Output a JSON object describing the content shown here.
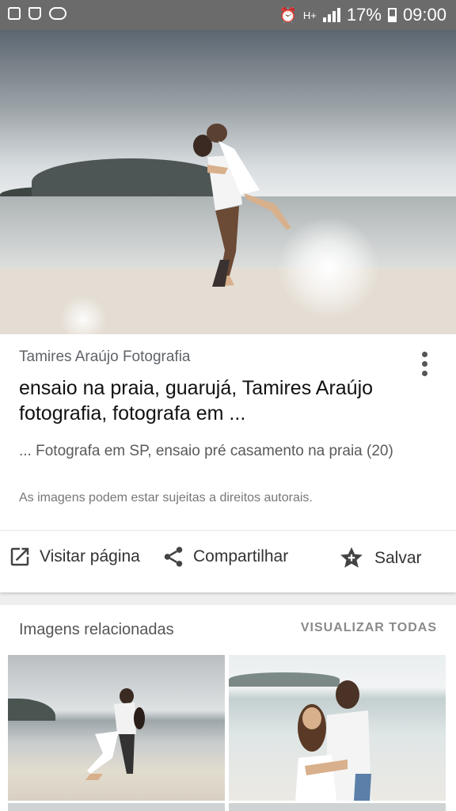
{
  "status_bar": {
    "left_icons": [
      "gallery-icon",
      "recycle-icon",
      "voicemail-icon"
    ],
    "alarm_icon": "alarm-icon",
    "network_label": "H+",
    "battery": "17%",
    "time": "09:00"
  },
  "hero": {
    "alt": "couple on beach"
  },
  "result": {
    "site": "Tamires Araújo Fotografia",
    "title": "ensaio na praia, guarujá, Tamires Araújo fotografia, fotografa em ...",
    "snippet": "... Fotografa em SP, ensaio pré casamento na praia (20)",
    "copyright": "As imagens podem estar sujeitas a direitos autorais."
  },
  "actions": {
    "visit": "Visitar página",
    "share": "Compartilhar",
    "save": "Salvar"
  },
  "related": {
    "title": "Imagens relacionadas",
    "view_all": "VISUALIZAR TODAS"
  },
  "colors": {
    "status_bar": "#6b6b6b",
    "background": "#eeeeee",
    "card": "#ffffff"
  }
}
